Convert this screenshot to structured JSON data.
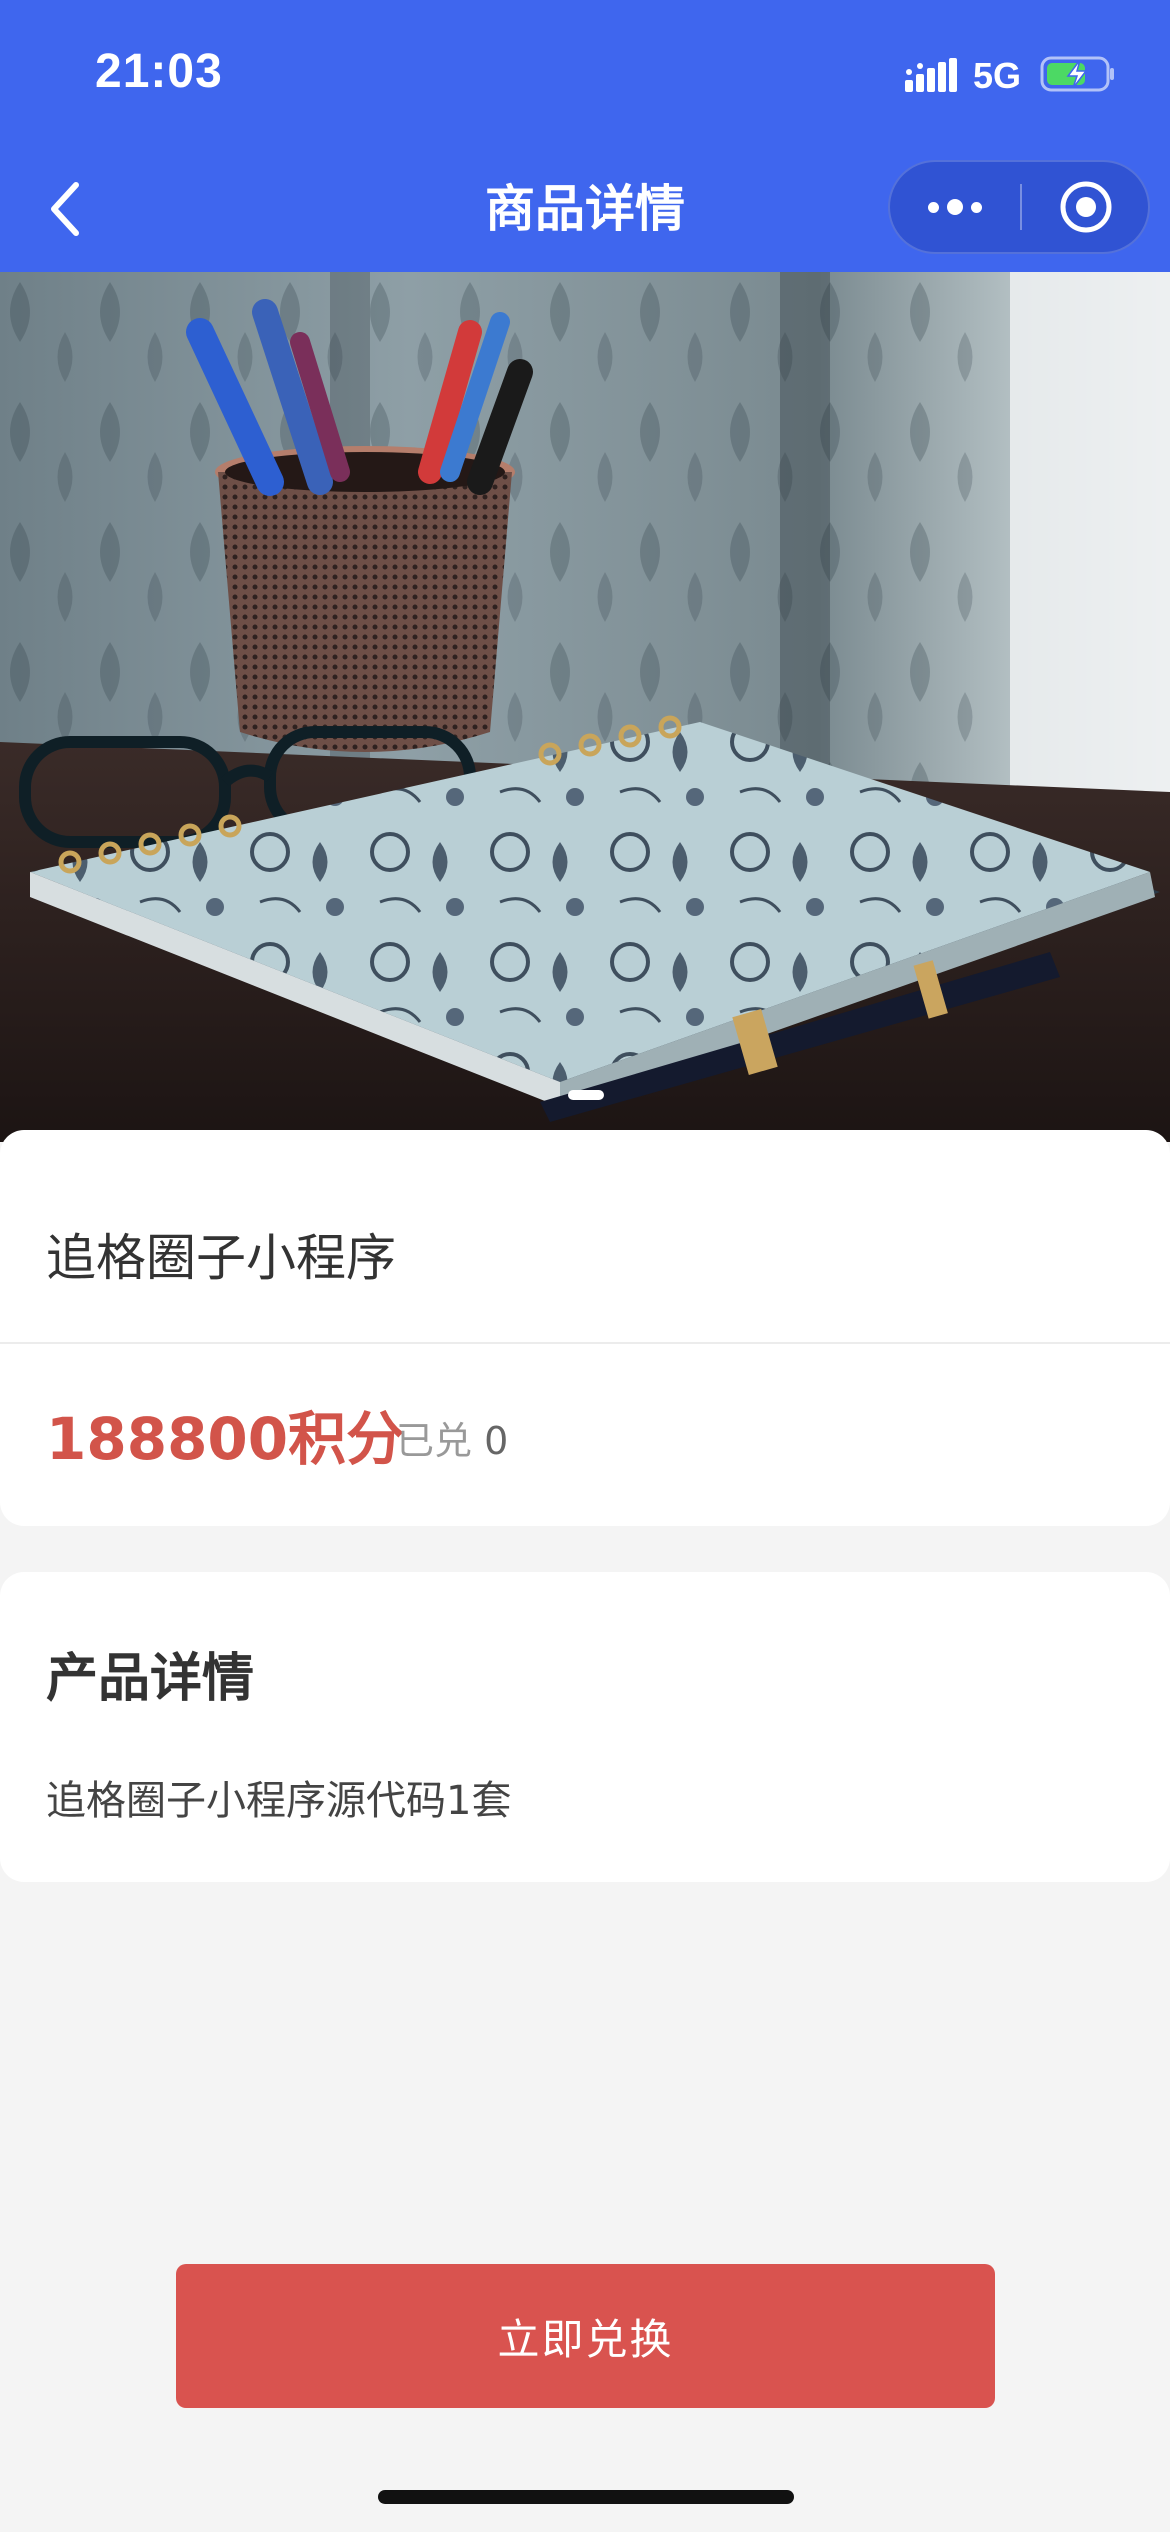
{
  "status_bar": {
    "time": "21:03",
    "network": "5G",
    "battery_color": "#4cd964"
  },
  "nav": {
    "title": "商品详情",
    "icons": [
      "back-chevron-icon",
      "more-dots-icon",
      "close-target-icon"
    ]
  },
  "product": {
    "image_description_icon": "product-photo-notebook-pens",
    "name": "追格圈子小程序",
    "price": "188800积分",
    "redeemed_label": "已兑",
    "redeemed_count": "0"
  },
  "detail": {
    "title": "产品详情",
    "content": "追格圈子小程序源代码1套"
  },
  "action": {
    "redeem_label": "立即兑换"
  },
  "colors": {
    "header": "#3f66ee",
    "accent": "#d9534f",
    "background": "#f4f4f4"
  }
}
